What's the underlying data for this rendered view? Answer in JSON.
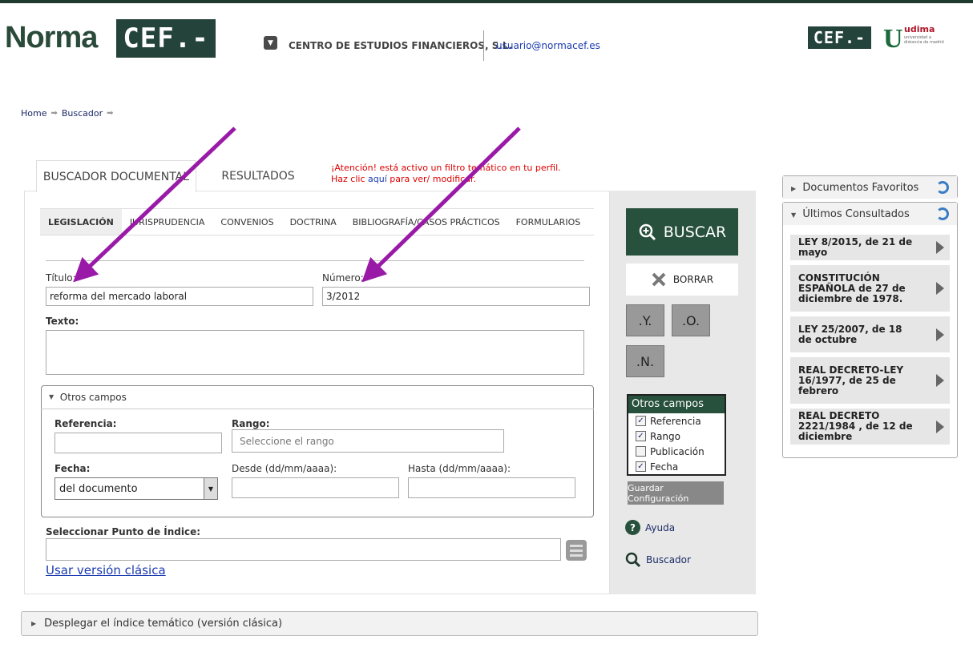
{
  "header": {
    "brand": "Norma",
    "brand_box": "CEF.-",
    "brand_small": "CEF.-",
    "udima_letter": "U",
    "udima_name": "udima",
    "udima_tagline": "universidad a distancia de madrid",
    "company": "CENTRO DE ESTUDIOS FINANCIEROS, S.L.",
    "email": "usuario@normacef.es"
  },
  "breadcrumb": [
    "Home",
    "Buscador"
  ],
  "tabs": {
    "search": "BUSCADOR DOCUMENTAL",
    "results": "RESULTADOS"
  },
  "alert": {
    "part1": "¡Atención! está activo un filtro temático en tu perfil. Haz clic ",
    "link": "aquí",
    "part2": " para ver/ modificar."
  },
  "subtabs": [
    "LEGISLACIÓN",
    "JURISPRUDENCIA",
    "CONVENIOS",
    "DOCTRINA",
    "BIBLIOGRAFÍA/CASOS PRÁCTICOS",
    "FORMULARIOS"
  ],
  "form": {
    "titulo_label": "Título:",
    "titulo_value": "reforma del mercado laboral",
    "numero_label": "Número:",
    "numero_value": "3/2012",
    "texto_label": "Texto:",
    "otros_campos": "Otros campos",
    "referencia_label": "Referencia:",
    "rango_label": "Rango:",
    "rango_placeholder": "Seleccione el rango",
    "fecha_label": "Fecha:",
    "fecha_value": "del documento",
    "desde_label": "Desde (dd/mm/aaaa):",
    "hasta_label": "Hasta (dd/mm/aaaa):",
    "indice_label": "Seleccionar Punto de Índice:",
    "classic_link": "Usar versión clásica"
  },
  "actions": {
    "buscar": "BUSCAR",
    "borrar": "BORRAR",
    "y": ".Y.",
    "o": ".O.",
    "n": ".N.",
    "config_title": "Otros campos",
    "config_items": [
      {
        "label": "Referencia",
        "checked": "✓"
      },
      {
        "label": "Rango",
        "checked": "✓"
      },
      {
        "label": "Publicación",
        "checked": ""
      },
      {
        "label": "Fecha",
        "checked": "✓"
      }
    ],
    "guardar": "Guardar Configuración",
    "ayuda": "Ayuda",
    "buscador": "Buscador"
  },
  "sidebar": {
    "favoritos": "Documentos Favoritos",
    "consultados": "Últimos Consultados",
    "items": [
      "LEY 8/2015, de 21 de mayo",
      "CONSTITUCIÓN ESPAÑOLA de 27 de diciembre de 1978.",
      "LEY 25/2007, de 18 de octubre",
      "REAL DECRETO-LEY 16/1977, de 25 de febrero",
      "REAL DECRETO 2221/1984 , de 12 de diciembre"
    ]
  },
  "footer": {
    "desplegar": "Desplegar el índice temático (versión clásica)"
  },
  "colors": {
    "brand_green": "#27503d",
    "link_blue": "#1a3ab0",
    "alert_red": "#dd0000",
    "arrow_purple": "#9a1aa8"
  }
}
